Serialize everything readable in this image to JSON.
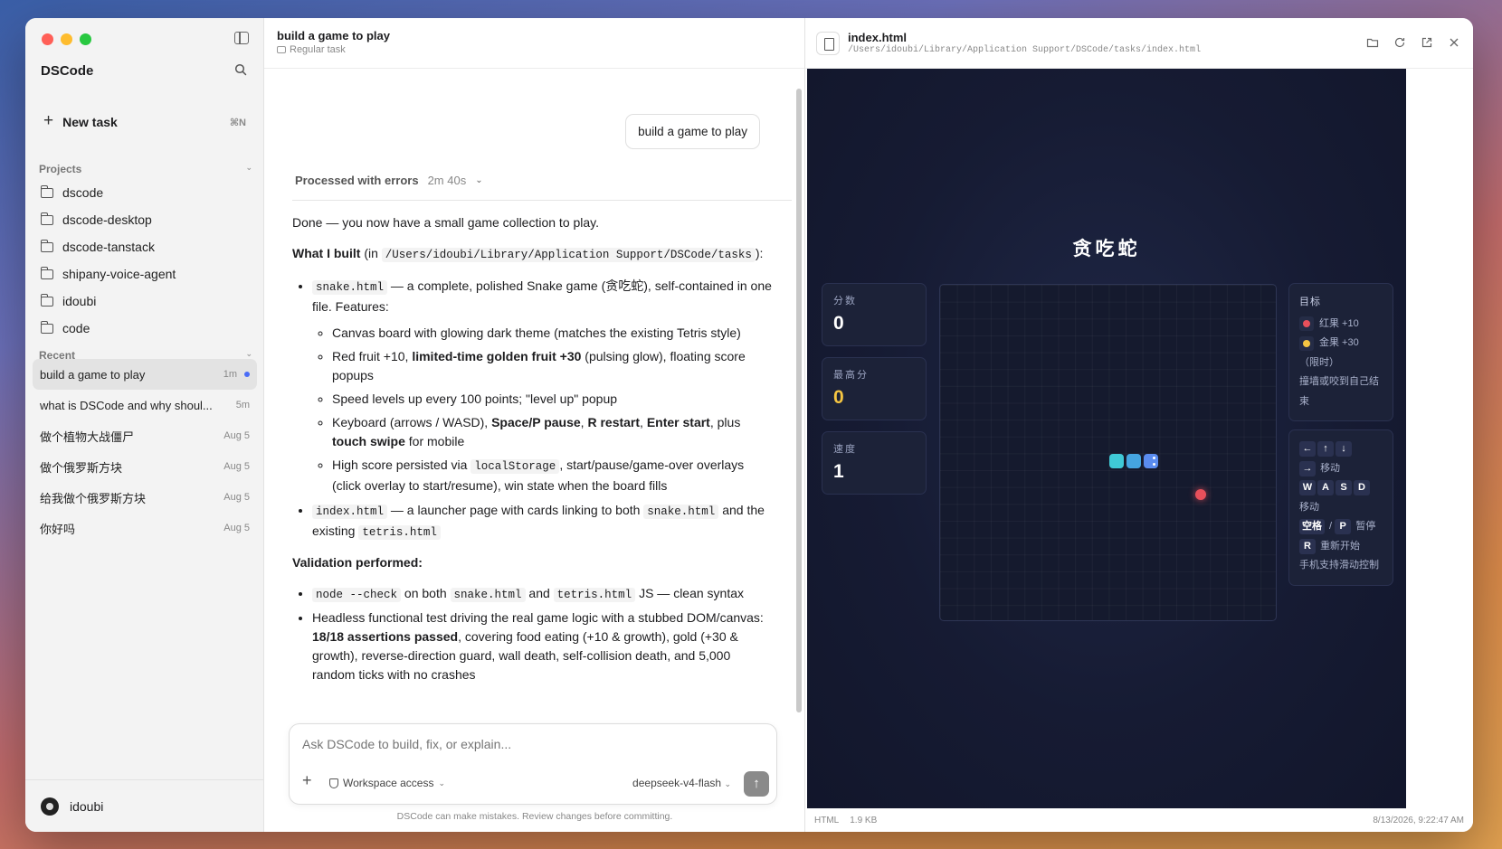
{
  "sidebar": {
    "app_title": "DSCode",
    "new_task": {
      "label": "New task",
      "shortcut": "⌘N"
    },
    "projects_header": "Projects",
    "projects": [
      "dscode",
      "dscode-desktop",
      "dscode-tanstack",
      "shipany-voice-agent",
      "idoubi",
      "code"
    ],
    "recent_header": "Recent",
    "recent": [
      {
        "label": "build a game to play",
        "time": "1m",
        "active": true
      },
      {
        "label": "what is DSCode and why shoul...",
        "time": "5m"
      },
      {
        "label": "做个植物大战僵尸",
        "time": "Aug 5"
      },
      {
        "label": "做个俄罗斯方块",
        "time": "Aug 5"
      },
      {
        "label": "给我做个俄罗斯方块",
        "time": "Aug 5"
      },
      {
        "label": "你好吗",
        "time": "Aug 5"
      }
    ],
    "user": "idoubi"
  },
  "chat": {
    "title": "build a game to play",
    "subtitle": "Regular task",
    "user_message": "build a game to play",
    "processed_label": "Processed with errors",
    "processed_time": "2m 40s",
    "intro": "Done — you now have a small game collection to play.",
    "built_heading": "What I built",
    "built_path": "/Users/idoubi/Library/Application Support/DSCode/tasks",
    "snake_file": "snake.html",
    "snake_desc": " — a complete, polished Snake game (贪吃蛇), self-contained in one file. Features:",
    "features": {
      "f1": "Canvas board with glowing dark theme (matches the existing Tetris style)",
      "f2_a": "Red fruit +10, ",
      "f2_b": "limited-time golden fruit +30",
      "f2_c": " (pulsing glow), floating score popups",
      "f3": "Speed levels up every 100 points; \"level up\" popup",
      "f4_a": "Keyboard (arrows / WASD), ",
      "f4_b": "Space/P pause",
      "f4_c": ", ",
      "f4_d": "R restart",
      "f4_e": "Enter start",
      "f4_f": ", plus ",
      "f4_g": "touch swipe",
      "f4_h": " for mobile",
      "f5_a": "High score persisted via ",
      "f5_code": "localStorage",
      "f5_b": ", start/pause/game-over overlays (click overlay to start/resume), win state when the board fills"
    },
    "index_file": "index.html",
    "index_desc": " — a launcher page with cards linking to both ",
    "index_and": " and the existing ",
    "tetris_file": "tetris.html",
    "validation_heading": "Validation performed:",
    "val1_code": "node --check",
    "val1_a": " on both ",
    "val1_b": " and ",
    "val1_c": " JS — clean syntax",
    "val2_a": "Headless functional test driving the real game logic with a stubbed DOM/canvas: ",
    "val2_b": "18/18 assertions passed",
    "val2_c": ", covering food eating (+10 & growth), gold (+30 & growth), reverse-direction guard, wall death, self-collision death, and 5,000 random ticks with no crashes",
    "composer_placeholder": "Ask DSCode to build, fix, or explain...",
    "workspace": "Workspace access",
    "model": "deepseek-v4-flash",
    "disclaimer": "DSCode can make mistakes. Review changes before committing."
  },
  "preview": {
    "file_name": "index.html",
    "file_path": "/Users/idoubi/Library/Application Support/DSCode/tasks/index.html",
    "footer_type": "HTML",
    "footer_size": "1.9 KB",
    "footer_date": "8/13/2026, 9:22:47 AM",
    "game": {
      "title": "贪吃蛇",
      "score_label": "分数",
      "score": "0",
      "high_label": "最高分",
      "high": "0",
      "speed_label": "速度",
      "speed": "1",
      "goal_header": "目标",
      "red_fruit": "红果 +10",
      "gold_fruit": "金果 +30",
      "gold_note": "（限时）",
      "death_rule": "撞墙或咬到自己结束",
      "move_label": "移动",
      "pause_key": "空格",
      "pause_alt": "P",
      "pause_label": "暂停",
      "restart_key": "R",
      "restart_label": "重新开始",
      "touch_note": "手机支持滑动控制"
    }
  }
}
